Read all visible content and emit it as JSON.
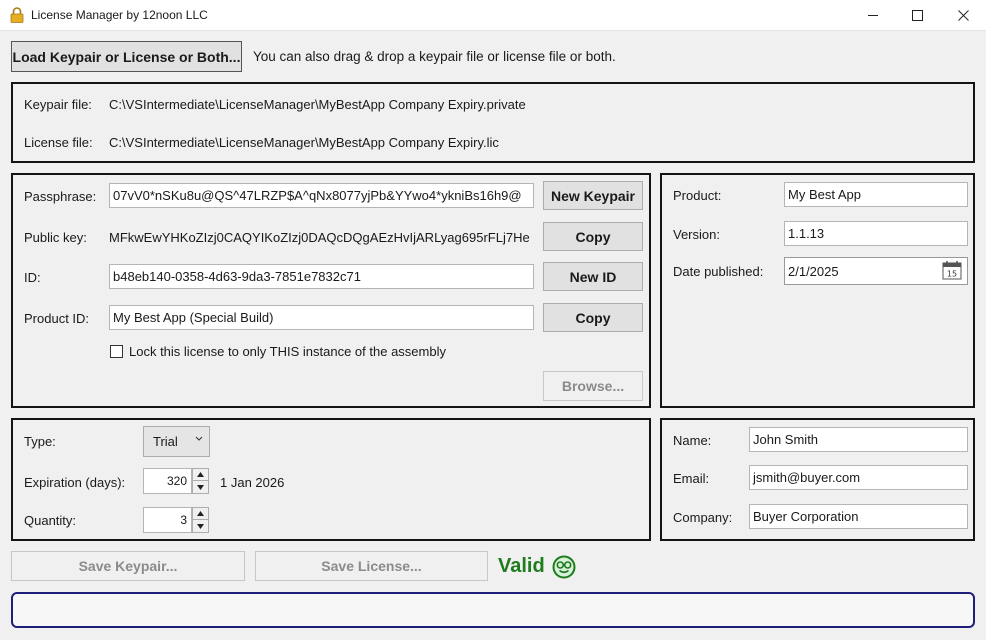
{
  "window": {
    "title": "License Manager by 12noon LLC"
  },
  "top": {
    "load_button": "Load Keypair or License or Both...",
    "drag_hint": "You can also drag & drop a keypair file or license file or both."
  },
  "files": {
    "keypair_label": "Keypair file:",
    "keypair_path": "C:\\VSIntermediate\\LicenseManager\\MyBestApp Company Expiry.private",
    "license_label": "License file:",
    "license_path": "C:\\VSIntermediate\\LicenseManager\\MyBestApp Company Expiry.lic"
  },
  "keys": {
    "passphrase_label": "Passphrase:",
    "passphrase_value": "07vV0*nSKu8u@QS^47LRZP$A^qNx8077yjPb&YYwo4*ykniBs16h9@",
    "new_keypair_button": "New Keypair",
    "public_key_label": "Public key:",
    "public_key_value": "MFkwEwYHKoZIzj0CAQYIKoZIzj0DAQcDQgAEzHvIjARLyag695rFLj7He",
    "copy_button": "Copy",
    "id_label": "ID:",
    "id_value": "b48eb140-0358-4d63-9da3-7851e7832c71",
    "new_id_button": "New ID",
    "product_id_label": "Product ID:",
    "product_id_value": "My Best App (Special Build)",
    "copy_button_2": "Copy",
    "lock_checkbox_label": "Lock this license to only THIS instance of the assembly",
    "lock_checked": false,
    "browse_button": "Browse..."
  },
  "product": {
    "product_label": "Product:",
    "product_value": "My Best App",
    "version_label": "Version:",
    "version_value": "1.1.13",
    "date_label": "Date published:",
    "date_value": "2/1/2025",
    "calendar_day": "15"
  },
  "license": {
    "type_label": "Type:",
    "type_value": "Trial",
    "expiration_label": "Expiration (days):",
    "expiration_value": "320",
    "expiration_date": "1 Jan 2026",
    "quantity_label": "Quantity:",
    "quantity_value": "3"
  },
  "customer": {
    "name_label": "Name:",
    "name_value": "John Smith",
    "email_label": "Email:",
    "email_value": "jsmith@buyer.com",
    "company_label": "Company:",
    "company_value": "Buyer Corporation"
  },
  "bottom": {
    "save_keypair_button": "Save Keypair...",
    "save_license_button": "Save License...",
    "status_text": "Valid",
    "status_message": ""
  },
  "colors": {
    "valid_green": "#1e7b1e",
    "panel_border": "#141414",
    "status_border": "#1f1f7a",
    "lock_icon": "#d9a21b"
  }
}
